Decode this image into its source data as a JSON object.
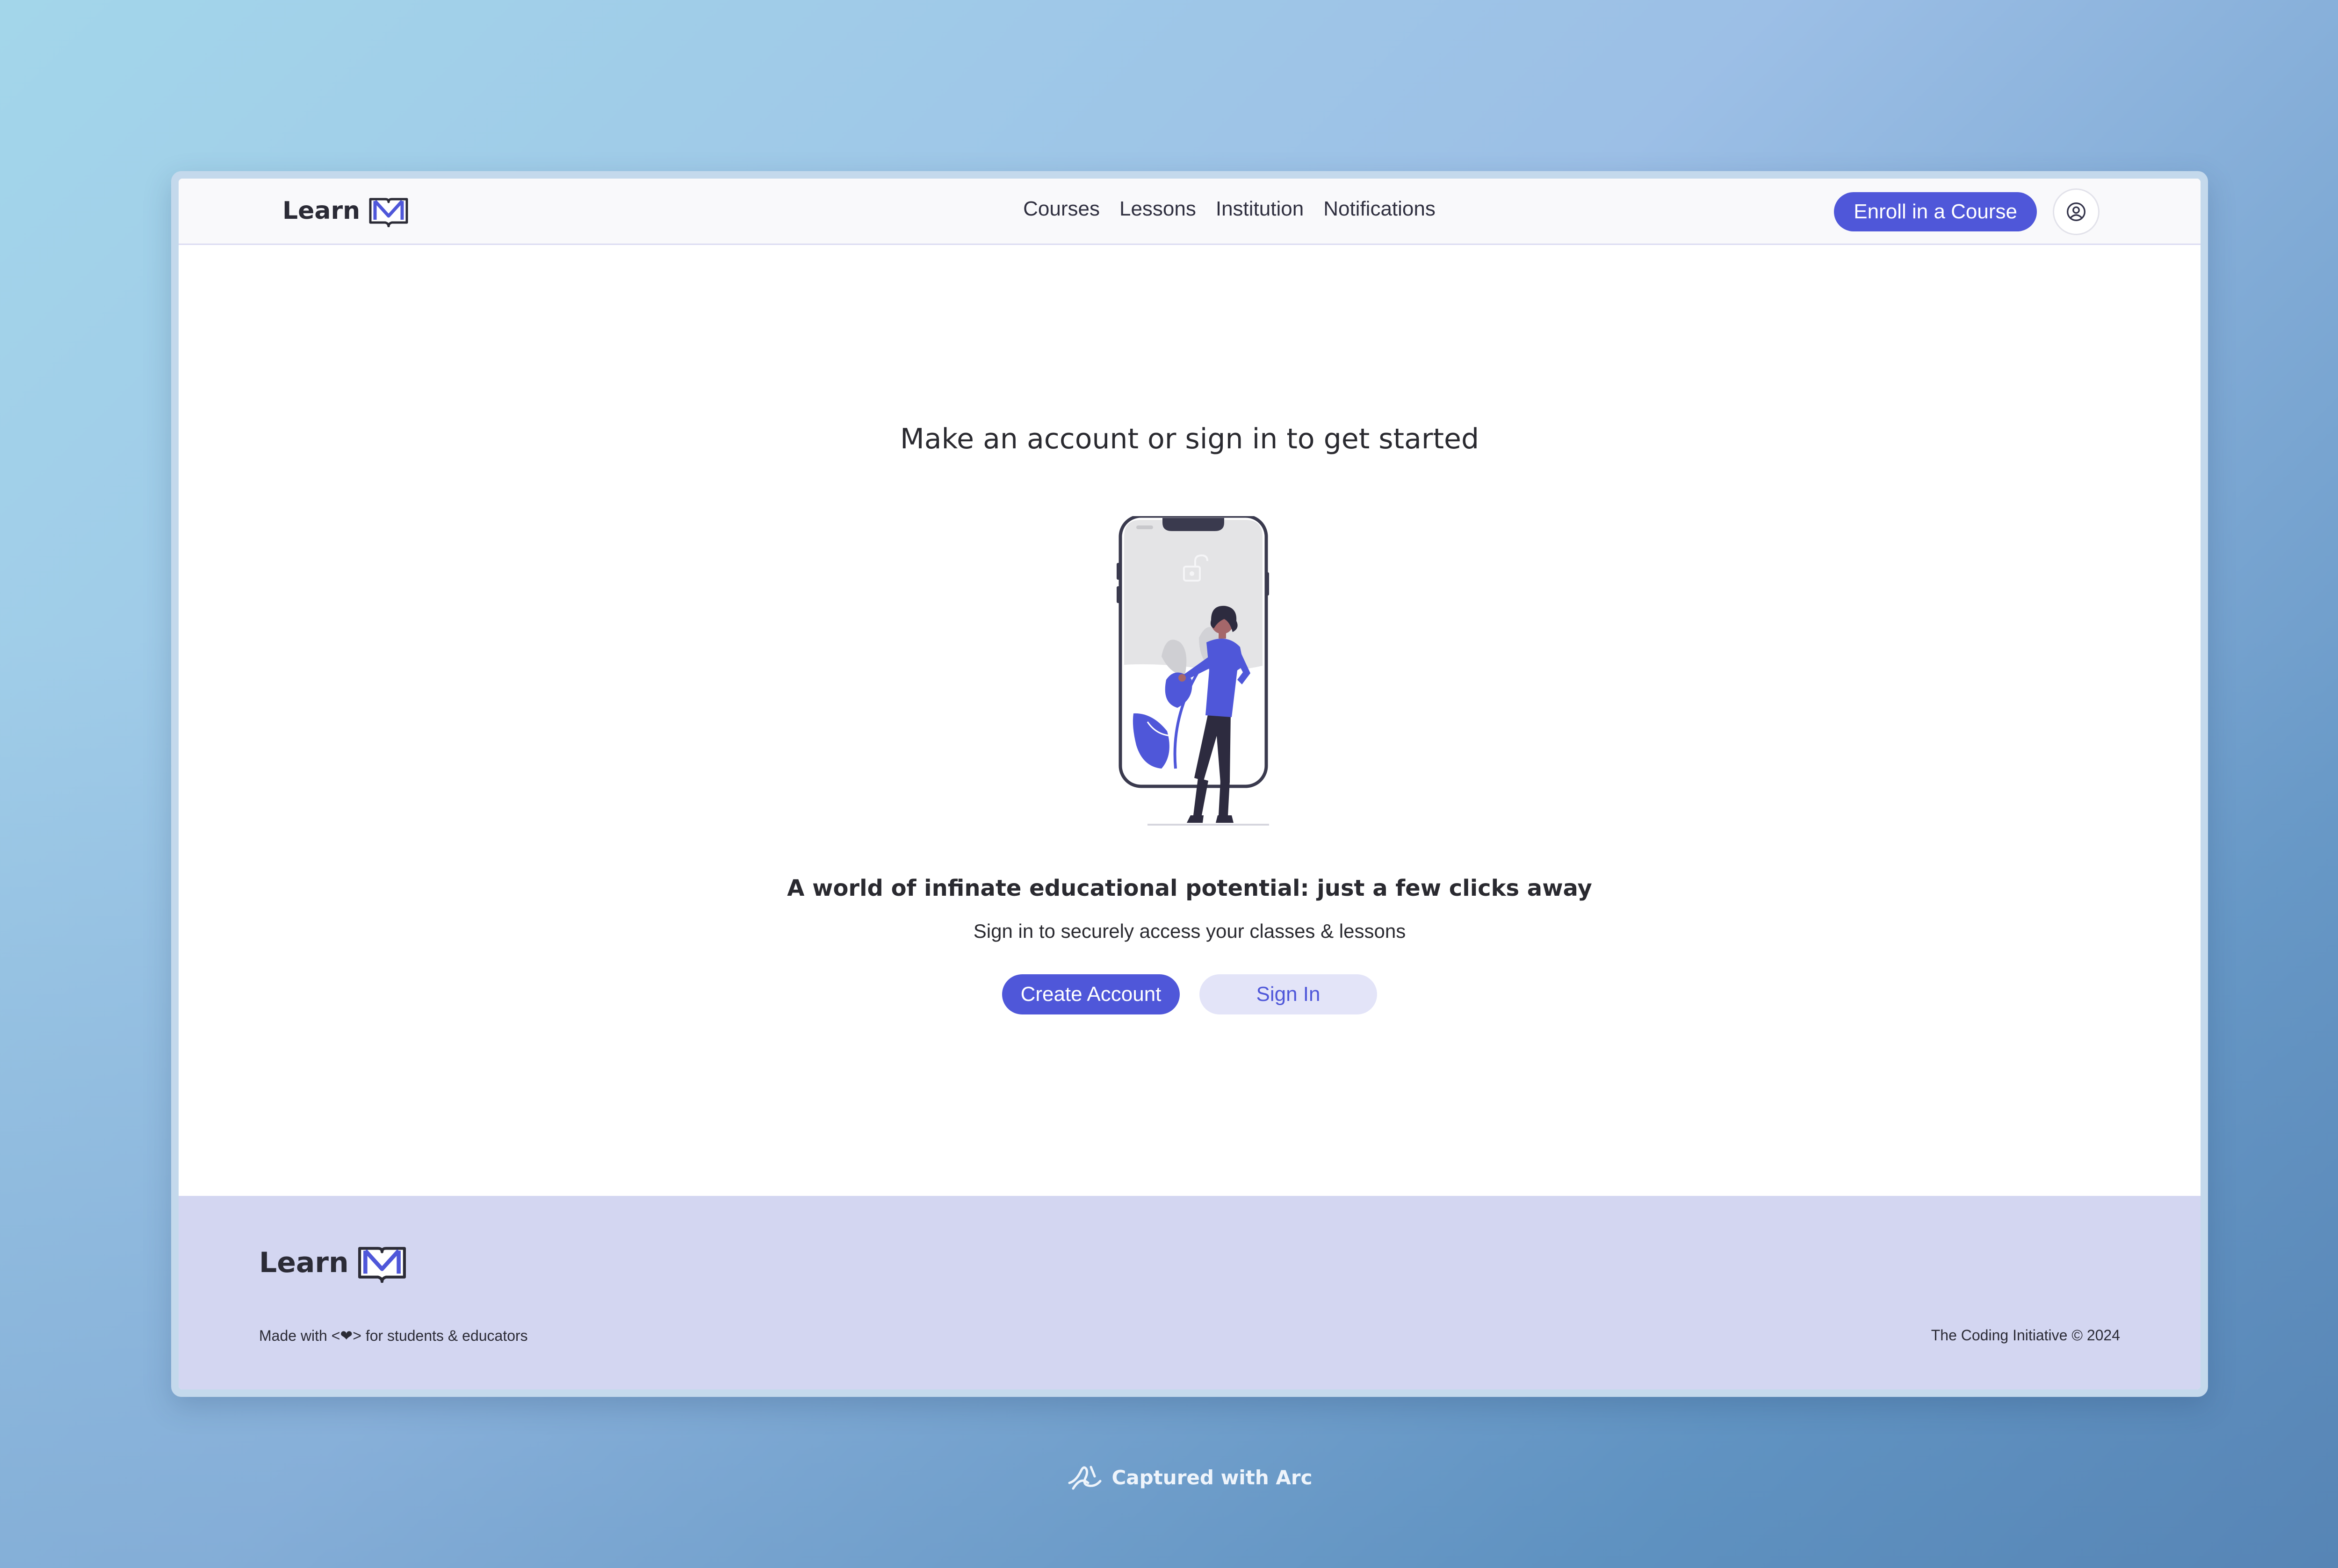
{
  "header": {
    "brand": "Learn",
    "nav": [
      "Courses",
      "Lessons",
      "Institution",
      "Notifications"
    ],
    "enroll_label": "Enroll in a Course"
  },
  "main": {
    "headline": "Make an account or sign in to get started",
    "tagline": "A world of infinate educational potential: just a few clicks away",
    "subtext": "Sign in to securely access your classes & lessons",
    "create_label": "Create Account",
    "signin_label": "Sign In"
  },
  "footer": {
    "brand": "Learn",
    "made_with": "Made with <❤> for students & educators",
    "copyright": "The Coding Initiative © 2024"
  },
  "watermark": {
    "label": "Captured with Arc"
  },
  "colors": {
    "accent": "#4f57d9",
    "accent_light": "#e3e4f8",
    "footer_bg": "#d3d6f1",
    "text": "#2a2a30"
  }
}
